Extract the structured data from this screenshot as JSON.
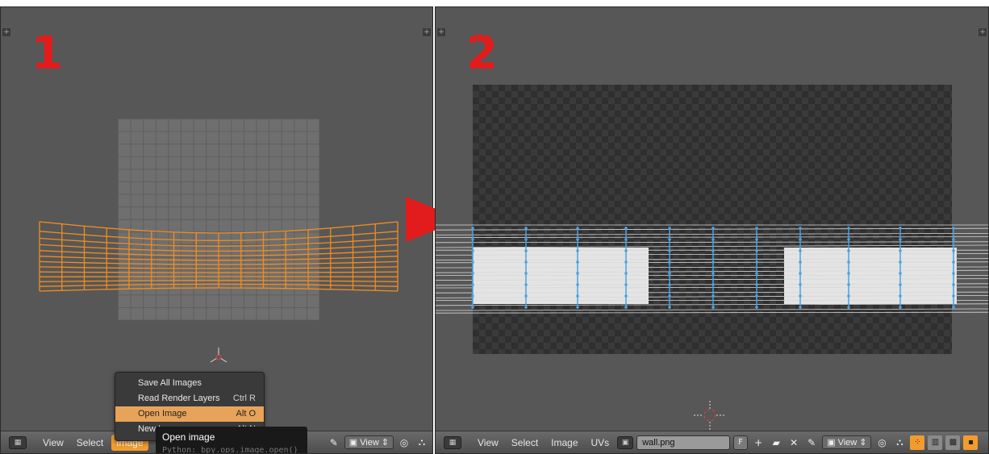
{
  "step_labels": [
    "1",
    "2"
  ],
  "left_header": {
    "menu": [
      "View",
      "Select",
      "Image"
    ],
    "active_menu": "Image",
    "view_dropdown": "View"
  },
  "image_menu": {
    "items": [
      {
        "label": "Save All Images",
        "shortcut": ""
      },
      {
        "label": "Read Render Layers",
        "shortcut": "Ctrl R"
      },
      {
        "label": "Open Image",
        "shortcut": "Alt O"
      },
      {
        "label": "New Image",
        "shortcut": "Alt N"
      }
    ],
    "highlighted_index": 2
  },
  "tooltip": {
    "title": "Open image",
    "python": "Python: bpy.ops.image.open()"
  },
  "right_header": {
    "menu": [
      "View",
      "Select",
      "Image",
      "UVs"
    ],
    "image_name": "wall.png",
    "fake_user": "F",
    "view_dropdown": "View"
  },
  "colors": {
    "panel_bg": "#575757",
    "accent": "#f29c2e",
    "arrow": "#e21c1c",
    "uv_selected": "#f28c1e",
    "uv_vertex_blue": "#4aa3e0"
  },
  "icons": [
    "editor-type-icon",
    "pin-icon",
    "image-icon",
    "pivot-icon",
    "uv-sync-icon",
    "plus-icon",
    "folder-icon",
    "close-icon",
    "vertex-mode-icon",
    "edge-mode-icon",
    "face-mode-icon",
    "island-mode-icon"
  ]
}
